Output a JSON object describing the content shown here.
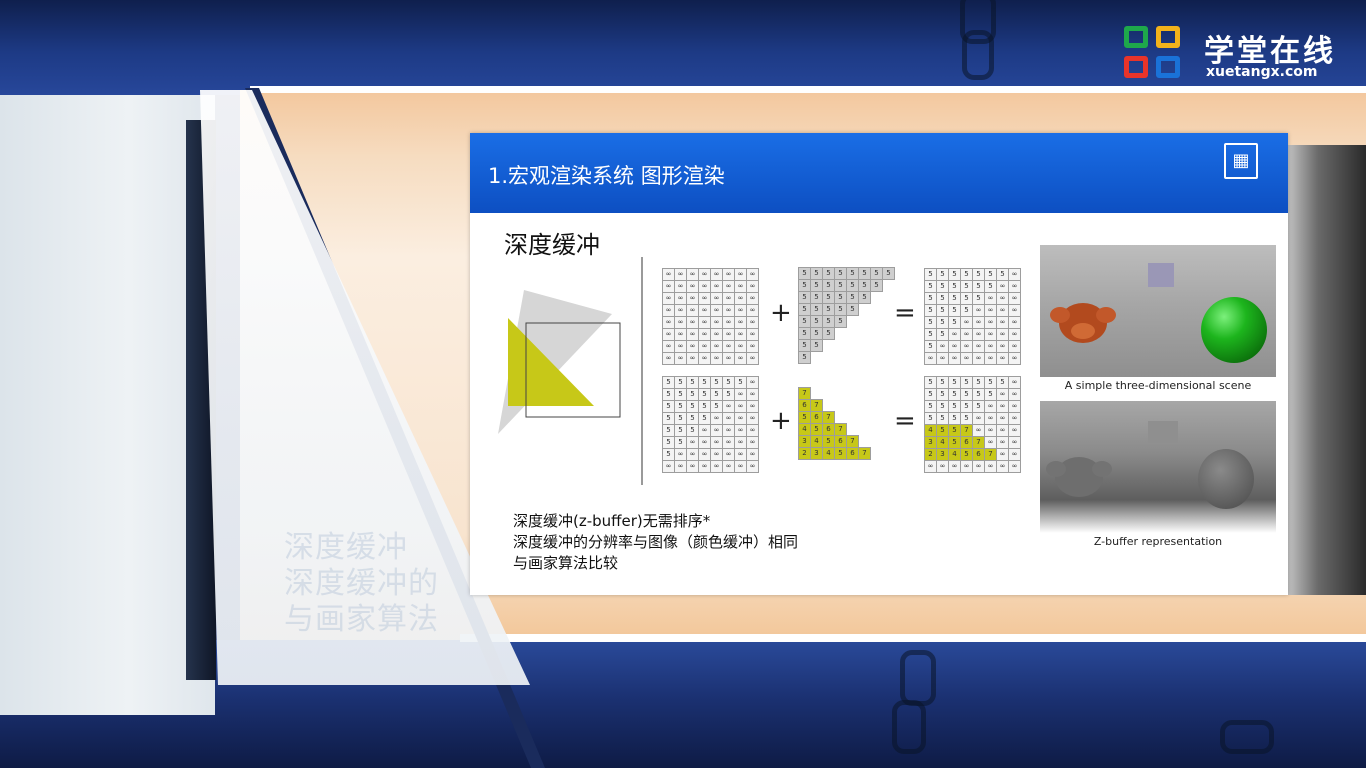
{
  "logo": {
    "name_cn": "学堂在线",
    "domain": "xuetangx.com",
    "colors": [
      "#1ea84b",
      "#f2b21b",
      "#e8342a",
      "#1a72d8"
    ]
  },
  "background_ghost_text": [
    "深度缓冲",
    "深度缓冲的",
    "与画家算法"
  ],
  "slide": {
    "title": "1.宏观渲染系统  图形渲染",
    "header_color": "#0d5bd2",
    "section_title": "深度缓冲",
    "operators": {
      "plus": "+",
      "equals": "="
    },
    "zbuffer_rows": {
      "initial": [
        [
          "∞",
          "∞",
          "∞",
          "∞",
          "∞",
          "∞",
          "∞",
          "∞"
        ],
        [
          "∞",
          "∞",
          "∞",
          "∞",
          "∞",
          "∞",
          "∞",
          "∞"
        ],
        [
          "∞",
          "∞",
          "∞",
          "∞",
          "∞",
          "∞",
          "∞",
          "∞"
        ],
        [
          "∞",
          "∞",
          "∞",
          "∞",
          "∞",
          "∞",
          "∞",
          "∞"
        ],
        [
          "∞",
          "∞",
          "∞",
          "∞",
          "∞",
          "∞",
          "∞",
          "∞"
        ],
        [
          "∞",
          "∞",
          "∞",
          "∞",
          "∞",
          "∞",
          "∞",
          "∞"
        ],
        [
          "∞",
          "∞",
          "∞",
          "∞",
          "∞",
          "∞",
          "∞",
          "∞"
        ],
        [
          "∞",
          "∞",
          "∞",
          "∞",
          "∞",
          "∞",
          "∞",
          "∞"
        ]
      ],
      "gray_triangle": [
        [
          "5",
          "5",
          "5",
          "5",
          "5",
          "5",
          "5",
          "5"
        ],
        [
          "5",
          "5",
          "5",
          "5",
          "5",
          "5",
          "5",
          ""
        ],
        [
          "5",
          "5",
          "5",
          "5",
          "5",
          "5",
          "",
          ""
        ],
        [
          "5",
          "5",
          "5",
          "5",
          "5",
          "",
          "",
          ""
        ],
        [
          "5",
          "5",
          "5",
          "5",
          "",
          "",
          "",
          ""
        ],
        [
          "5",
          "5",
          "5",
          "",
          "",
          "",
          "",
          ""
        ],
        [
          "5",
          "5",
          "",
          "",
          "",
          "",
          "",
          ""
        ],
        [
          "5",
          "",
          "",
          "",
          "",
          "",
          "",
          ""
        ]
      ],
      "after_gray": [
        [
          "5",
          "5",
          "5",
          "5",
          "5",
          "5",
          "5",
          "∞"
        ],
        [
          "5",
          "5",
          "5",
          "5",
          "5",
          "5",
          "∞",
          "∞"
        ],
        [
          "5",
          "5",
          "5",
          "5",
          "5",
          "∞",
          "∞",
          "∞"
        ],
        [
          "5",
          "5",
          "5",
          "5",
          "∞",
          "∞",
          "∞",
          "∞"
        ],
        [
          "5",
          "5",
          "5",
          "∞",
          "∞",
          "∞",
          "∞",
          "∞"
        ],
        [
          "5",
          "5",
          "∞",
          "∞",
          "∞",
          "∞",
          "∞",
          "∞"
        ],
        [
          "5",
          "∞",
          "∞",
          "∞",
          "∞",
          "∞",
          "∞",
          "∞"
        ],
        [
          "∞",
          "∞",
          "∞",
          "∞",
          "∞",
          "∞",
          "∞",
          "∞"
        ]
      ],
      "yellow_triangle": [
        [
          "7",
          "",
          "",
          "",
          "",
          "",
          "",
          ""
        ],
        [
          "6",
          "7",
          "",
          "",
          "",
          "",
          "",
          ""
        ],
        [
          "5",
          "6",
          "7",
          "",
          "",
          "",
          "",
          ""
        ],
        [
          "4",
          "5",
          "6",
          "7",
          "",
          "",
          "",
          ""
        ],
        [
          "3",
          "4",
          "5",
          "6",
          "7",
          "",
          "",
          ""
        ],
        [
          "2",
          "3",
          "4",
          "5",
          "6",
          "7",
          "",
          ""
        ]
      ],
      "final": [
        [
          "5",
          "5",
          "5",
          "5",
          "5",
          "5",
          "5",
          "∞"
        ],
        [
          "5",
          "5",
          "5",
          "5",
          "5",
          "5",
          "∞",
          "∞"
        ],
        [
          "5",
          "5",
          "5",
          "5",
          "5",
          "∞",
          "∞",
          "∞"
        ],
        [
          "5",
          "5",
          "5",
          "5",
          "∞",
          "∞",
          "∞",
          "∞"
        ],
        [
          "4",
          "5",
          "5",
          "7",
          "∞",
          "∞",
          "∞",
          "∞"
        ],
        [
          "3",
          "4",
          "5",
          "6",
          "7",
          "∞",
          "∞",
          "∞"
        ],
        [
          "2",
          "3",
          "4",
          "5",
          "6",
          "7",
          "∞",
          "∞"
        ],
        [
          "∞",
          "∞",
          "∞",
          "∞",
          "∞",
          "∞",
          "∞",
          "∞"
        ]
      ]
    },
    "scene_caption": "A simple three-dimensional scene",
    "zbuffer_caption": "Z-buffer representation",
    "bullets": [
      "深度缓冲(z-buffer)无需排序*",
      "深度缓冲的分辨率与图像（颜色缓冲）相同",
      "与画家算法比较"
    ],
    "accent_yellow": "#c7c818"
  }
}
